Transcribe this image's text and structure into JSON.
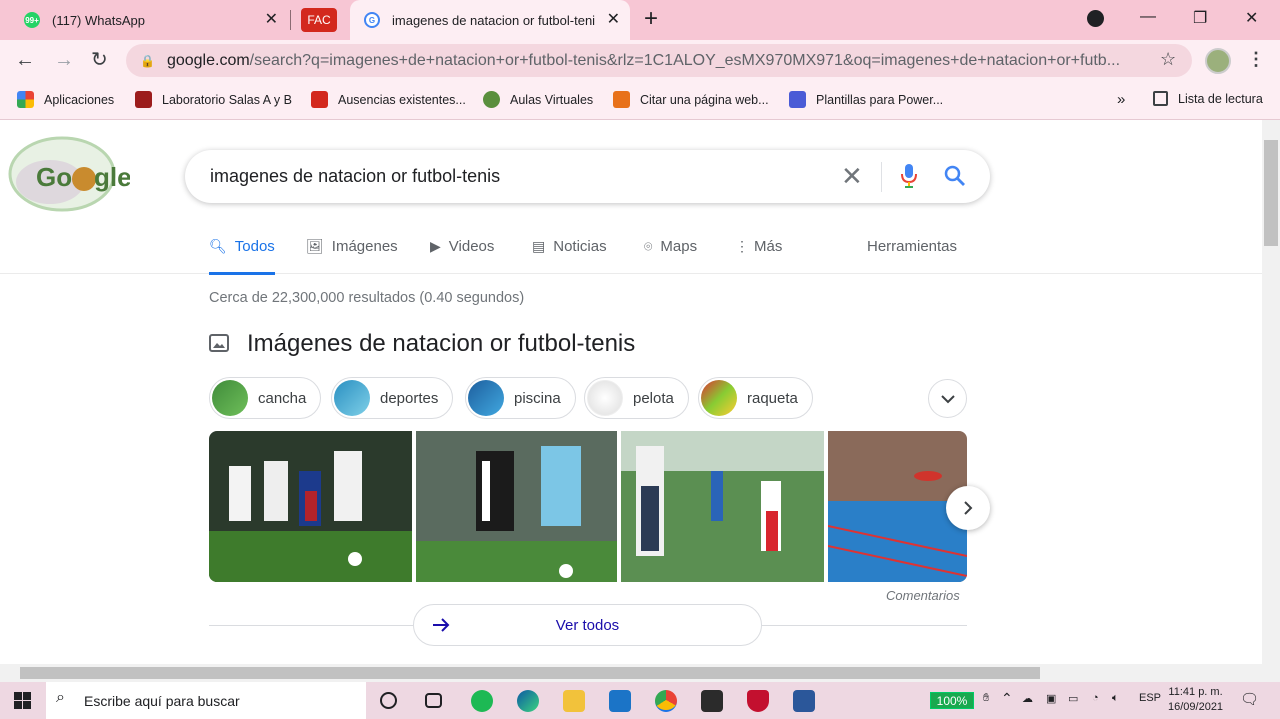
{
  "tabs": [
    {
      "label": "(117) WhatsApp",
      "badge": "99+"
    },
    {
      "label": "FAC"
    },
    {
      "label": "imagenes de natacion or futbol-teni"
    }
  ],
  "omnibox": {
    "host": "google.com",
    "path": "/search?q=imagenes+de+natacion+or+futbol-tenis&rlz=1C1ALOY_esMX970MX971&oq=imagenes+de+natacion+or+futb..."
  },
  "bookmarks": [
    {
      "label": "Aplicaciones",
      "color": "#ea4335"
    },
    {
      "label": "Laboratorio Salas A y B",
      "color": "#9c1c1c"
    },
    {
      "label": "Ausencias existentes...",
      "color": "#d3281d"
    },
    {
      "label": "Aulas Virtuales",
      "color": "#5a8f3d"
    },
    {
      "label": "Citar una página web...",
      "color": "#e8711a"
    },
    {
      "label": "Plantillas para Power...",
      "color": "#4a5bd6"
    }
  ],
  "bookmarks_more": "»",
  "reading_list": "Lista de lectura",
  "search": {
    "query": "imagenes de natacion or futbol-tenis"
  },
  "nav": {
    "todos": "Todos",
    "imagenes": "Imágenes",
    "videos": "Videos",
    "noticias": "Noticias",
    "maps": "Maps",
    "mas": "Más",
    "herramientas": "Herramientas"
  },
  "stats": "Cerca de 22,300,000 resultados (0.40 segundos)",
  "images_title": "Imágenes de natacion or futbol-tenis",
  "chips": [
    "cancha",
    "deportes",
    "piscina",
    "pelota",
    "raqueta"
  ],
  "comentarios": "Comentarios",
  "ver_todos": "Ver todos",
  "taskbar": {
    "search_placeholder": "Escribe aquí para buscar",
    "battery": "100%",
    "lang": "ESP",
    "time": "11:41 p. m.",
    "date": "16/09/2021"
  },
  "colors": {
    "accent": "#1a73e8",
    "tabstrip": "#f7c6d4",
    "toolbar": "#fdeef3"
  }
}
